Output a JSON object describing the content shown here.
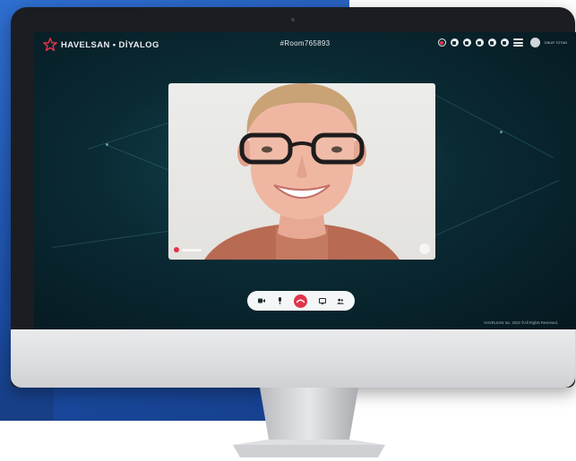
{
  "app": {
    "logo_text": "HAVELSAN • DİYALOG",
    "room_id": "#Room765893",
    "user_name": "ONUR TOTAN",
    "footer": "HAVELSAN Inc. 2022 ©All Rights Reserved."
  },
  "toolbar": {
    "icons": [
      "record-icon",
      "lock-icon",
      "pencil-icon",
      "info-icon",
      "chat-icon",
      "settings-icon",
      "menu-icon"
    ]
  },
  "controls": {
    "icons": [
      "camera-icon",
      "microphone-icon",
      "hangup-icon",
      "screen-share-icon",
      "participants-icon"
    ]
  },
  "colors": {
    "accent": "#e0344b",
    "screen_bg": "#0a2a33",
    "page_blue": "#1c4fa8"
  }
}
